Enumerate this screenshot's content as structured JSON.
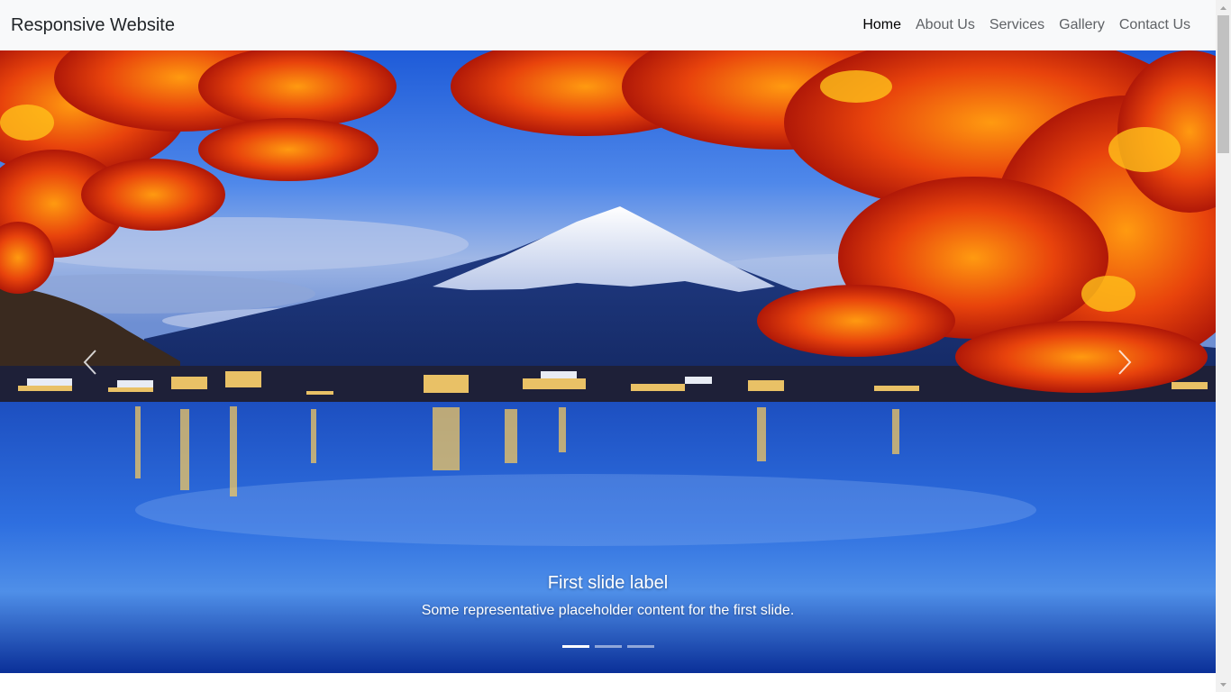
{
  "navbar": {
    "brand": "Responsive Website",
    "links": [
      {
        "label": "Home",
        "active": true
      },
      {
        "label": "About Us"
      },
      {
        "label": "Services"
      },
      {
        "label": "Gallery"
      },
      {
        "label": "Contact Us"
      }
    ]
  },
  "carousel": {
    "caption_title": "First slide label",
    "caption_text": "Some representative placeholder content for the first slide.",
    "indicators_total": 3,
    "active_indicator": 1,
    "prev_icon": "chevron-left-icon",
    "next_icon": "chevron-right-icon"
  },
  "colors": {
    "navbar_bg": "#f8f9fa",
    "active_link": "#000000",
    "link": "#5f6266"
  }
}
